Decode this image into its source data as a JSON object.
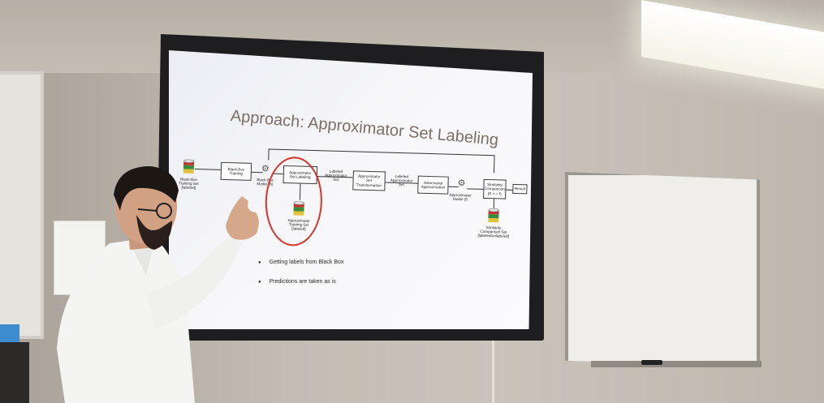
{
  "slide": {
    "title": "Approach: Approximator Set Labeling",
    "bullets": [
      "Getting labels from Black Box",
      "Predictions are taken as is"
    ]
  },
  "diagram": {
    "nodes": {
      "black_box_training_set": "Black-Box\nTraining Set\n[labeled]",
      "black_box_training": "Black-Box\nTraining",
      "black_box_model": "Black-Box\nModel (B)",
      "approximator_set_labeling": "Approximator\nSet Labeling",
      "approximator_training_set": "Approximator\nTraining Set\n[labeled]",
      "labeled_approximator_set_1": "Labeled\nApproximator\nSet",
      "approximator_set_transformation": "Approximator\nSet\nTransformation",
      "labeled_approximator_set_2": "Labeled\nApproximator\nSet",
      "adversarial_approximation": "Adversarial\nApproximation",
      "approximator_model": "Approximator\nModel (f)",
      "similarity_comparison": "Similarity\nComparison\n(B <-> f)",
      "result": "Result",
      "similarity_comparison_set": "Similarity\nComparison Set\n[labeled/unlabeled]"
    }
  },
  "colors": {
    "highlight": "#d8332b",
    "db_red": "#c8322a",
    "db_green": "#3c8a3a",
    "db_yellow": "#e2c23a"
  }
}
